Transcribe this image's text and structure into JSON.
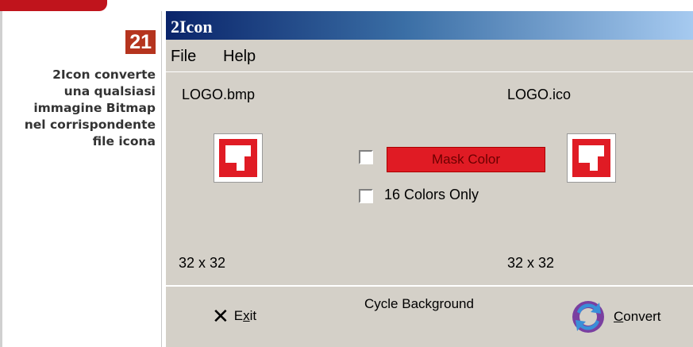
{
  "caption": {
    "figure_number": "21",
    "lines": [
      "2Icon converte",
      "una qualsiasi",
      "immagine Bitmap",
      "nel corrispondente",
      "file icona"
    ]
  },
  "window": {
    "title": "2Icon",
    "menu": [
      "File",
      "Help"
    ],
    "source_label": "LOGO.bmp",
    "target_label": "LOGO.ico",
    "mask_color_label": "Mask Color",
    "mask_color_hex": "#e01b24",
    "sixteen_colors_label": "16 Colors Only",
    "source_size": "32 x 32",
    "target_size": "32 x 32",
    "exit_label_prefix": "E",
    "exit_label_underlined": "x",
    "exit_label_suffix": "it",
    "cycle_background_label": "Cycle Background",
    "convert_label_underlined": "C",
    "convert_label_rest": "onvert"
  },
  "colors": {
    "accent_red": "#c0141c",
    "title_gradient_start": "#0a246a",
    "title_gradient_end": "#a6caf0",
    "window_face": "#d4d0c8"
  }
}
